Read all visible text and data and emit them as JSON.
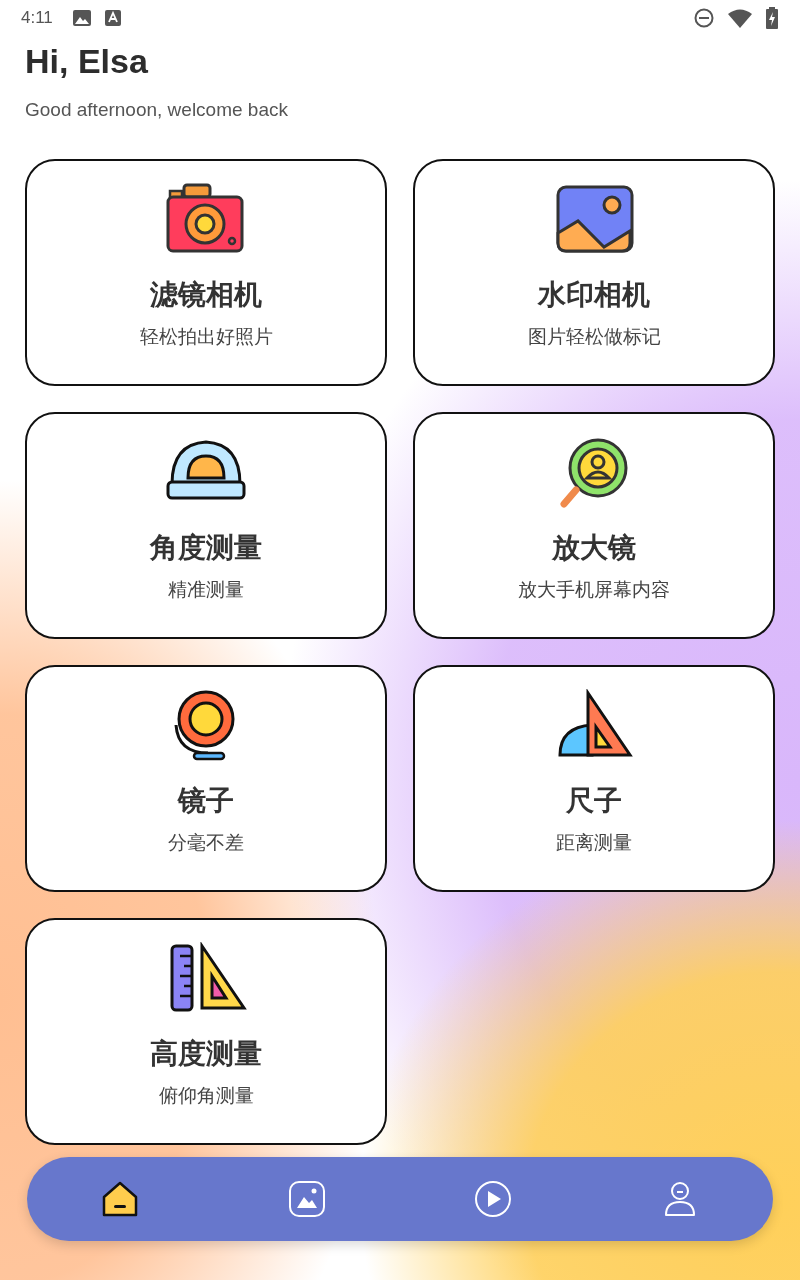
{
  "status_bar": {
    "time": "4:11"
  },
  "greeting": {
    "title": "Hi, Elsa",
    "subtitle": "Good afternoon, welcome back"
  },
  "cards": [
    {
      "title": "滤镜相机",
      "subtitle": "轻松拍出好照片"
    },
    {
      "title": "水印相机",
      "subtitle": "图片轻松做标记"
    },
    {
      "title": "角度测量",
      "subtitle": "精准测量"
    },
    {
      "title": "放大镜",
      "subtitle": "放大手机屏幕内容"
    },
    {
      "title": "镜子",
      "subtitle": "分毫不差"
    },
    {
      "title": "尺子",
      "subtitle": "距离测量"
    },
    {
      "title": "高度测量",
      "subtitle": "俯仰角测量"
    }
  ],
  "bottom_nav": [
    {
      "selected": true
    },
    {
      "selected": false
    },
    {
      "selected": false
    },
    {
      "selected": false
    }
  ]
}
